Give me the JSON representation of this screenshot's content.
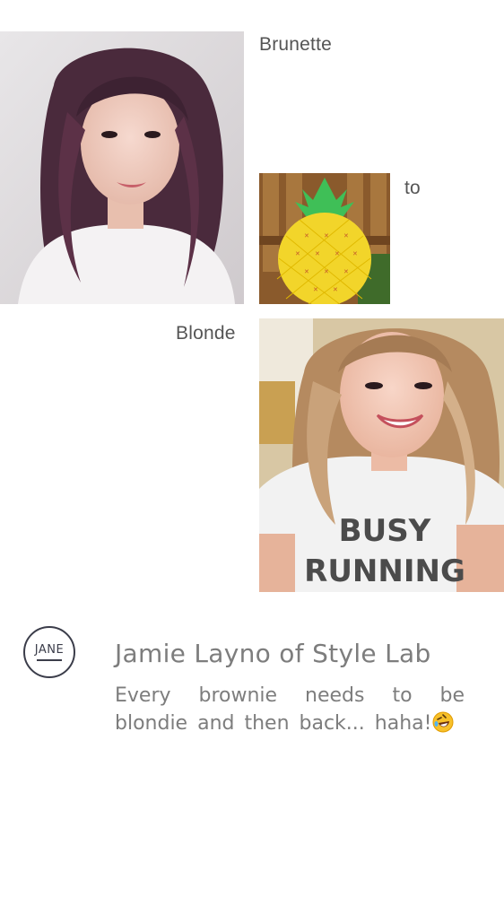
{
  "captions": {
    "brunette": "Brunette",
    "to": "to",
    "blonde": "Blonde"
  },
  "photos": {
    "brunette": {
      "icon": "brunette-selfie-photo"
    },
    "pineapple": {
      "icon": "pineapple-bag-photo"
    },
    "blonde": {
      "icon": "blonde-selfie-photo",
      "shirt_line1": "BUSY",
      "shirt_line2": "RUNNING"
    }
  },
  "author": {
    "avatar_text": "JANE",
    "name": "Jamie Layno of Style Lab",
    "message": "Every brownie needs to be blondie and then back... haha!",
    "emoji": "rolling-on-floor-laughing-emoji"
  },
  "colors": {
    "caption": "#555555",
    "author_text": "#7d7d7d",
    "avatar_border": "#3b3d4a",
    "pineapple_yellow": "#f2d52a",
    "leaf_green": "#3fbf57"
  }
}
